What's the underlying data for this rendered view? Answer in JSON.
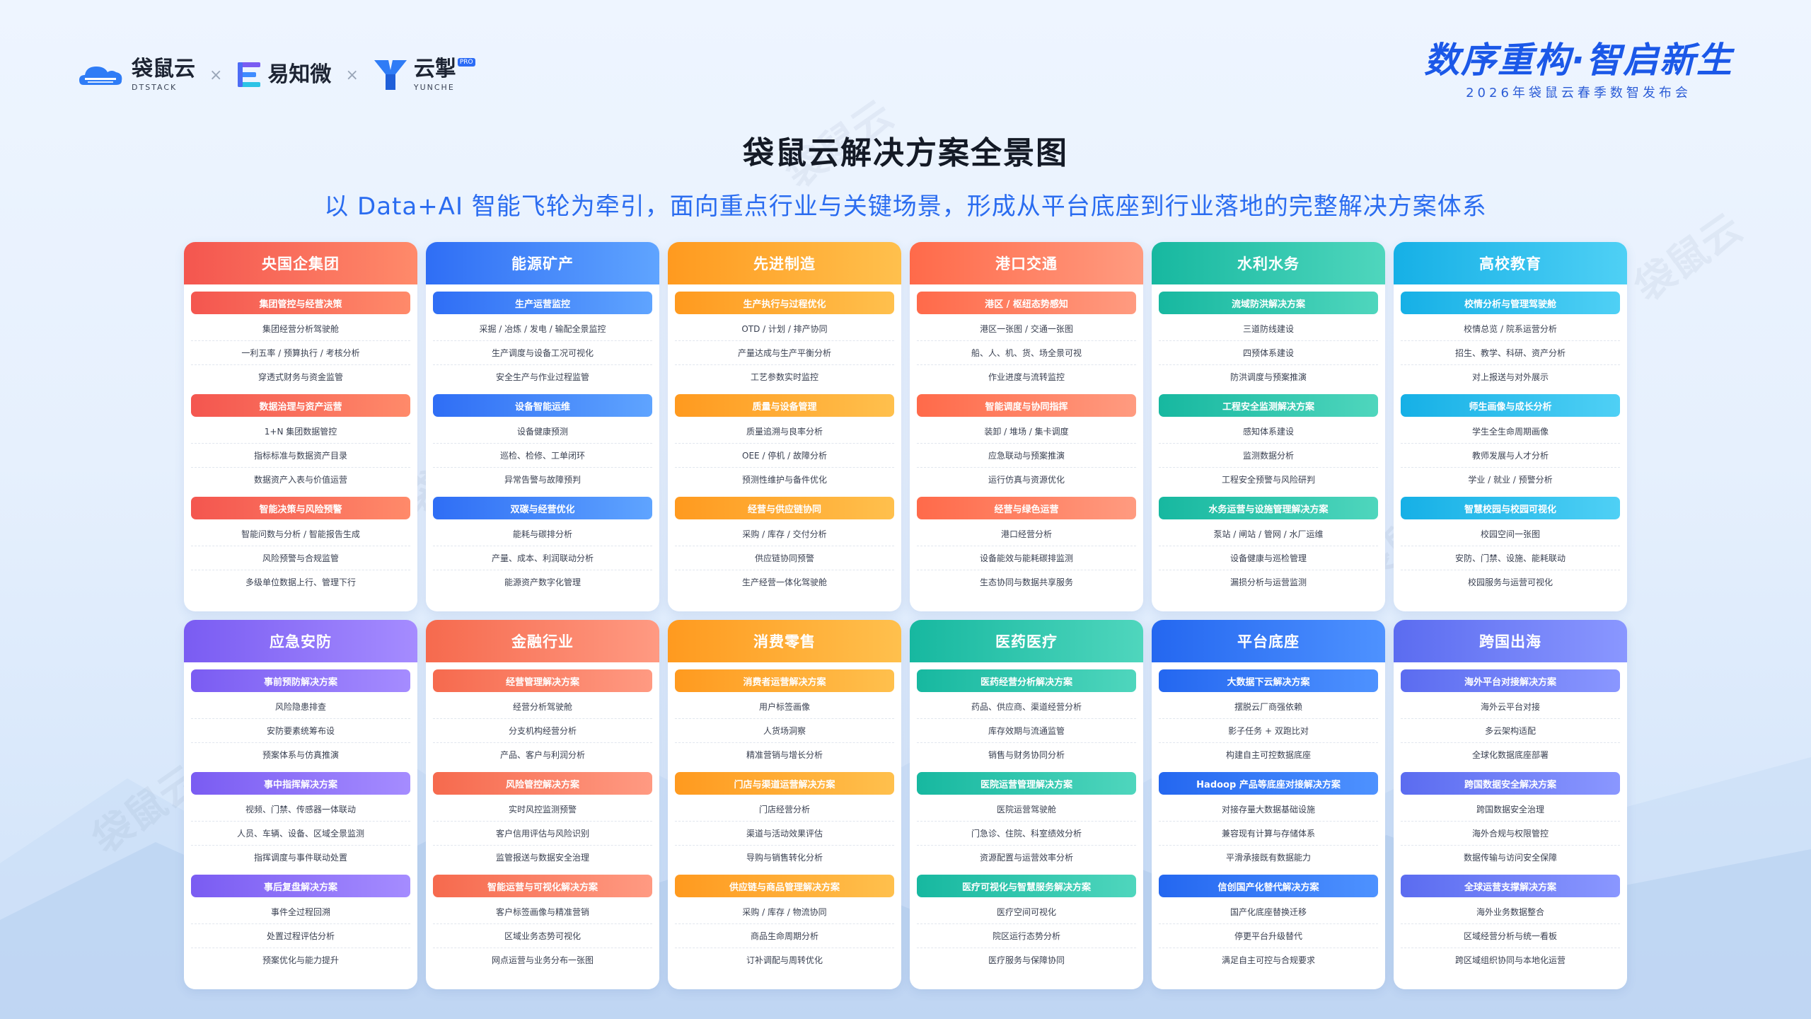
{
  "logos": {
    "brand1": "袋鼠云",
    "brand1_sub": "DTSTACK",
    "brand2": "易知微",
    "brand3": "云掣",
    "brand3_sub": "YUNCHE",
    "brand3_tag": "PRO",
    "separator": "×"
  },
  "event": {
    "title": "数序重构·智启新生",
    "subtitle": "2026年袋鼠云春季数智发布会"
  },
  "page": {
    "title": "袋鼠云解决方案全景图",
    "subtitle": "以 Data+AI 智能飞轮为牵引，面向重点行业与关键场景，形成从平台底座到行业落地的完整解决方案体系",
    "watermark": "袋鼠云"
  },
  "cards": [
    {
      "title": "央国企集团",
      "color": "c-red",
      "sections": [
        {
          "title": "集团管控与经营决策",
          "items": [
            "集团经营分析驾驶舱",
            "一利五率 / 预算执行 / 考核分析",
            "穿透式财务与资金监管"
          ]
        },
        {
          "title": "数据治理与资产运营",
          "items": [
            "1+N 集团数据管控",
            "指标标准与数据资产目录",
            "数据资产入表与价值运营"
          ]
        },
        {
          "title": "智能决策与风险预警",
          "items": [
            "智能问数与分析 / 智能报告生成",
            "风险预警与合规监管",
            "多级单位数据上行、管理下行"
          ]
        }
      ]
    },
    {
      "title": "能源矿产",
      "color": "c-blue",
      "sections": [
        {
          "title": "生产运营监控",
          "items": [
            "采掘 / 冶炼 / 发电 / 输配全景监控",
            "生产调度与设备工况可视化",
            "安全生产与作业过程监管"
          ]
        },
        {
          "title": "设备智能运维",
          "items": [
            "设备健康预测",
            "巡检、检修、工单闭环",
            "异常告警与故障预判"
          ]
        },
        {
          "title": "双碳与经营优化",
          "items": [
            "能耗与碳排分析",
            "产量、成本、利润联动分析",
            "能源资产数字化管理"
          ]
        }
      ]
    },
    {
      "title": "先进制造",
      "color": "c-orange",
      "sections": [
        {
          "title": "生产执行与过程优化",
          "items": [
            "OTD / 计划 / 排产协同",
            "产量达成与生产平衡分析",
            "工艺参数实时监控"
          ]
        },
        {
          "title": "质量与设备管理",
          "items": [
            "质量追溯与良率分析",
            "OEE / 停机 / 故障分析",
            "预测性维护与备件优化"
          ]
        },
        {
          "title": "经营与供应链协同",
          "items": [
            "采购 / 库存 / 交付分析",
            "供应链协同预警",
            "生产经营一体化驾驶舱"
          ]
        }
      ]
    },
    {
      "title": "港口交通",
      "color": "c-salmon",
      "sections": [
        {
          "title": "港区 / 枢纽态势感知",
          "items": [
            "港区一张图 / 交通一张图",
            "船、人、机、货、场全景可视",
            "作业进度与流转监控"
          ]
        },
        {
          "title": "智能调度与协同指挥",
          "items": [
            "装卸 / 堆场 / 集卡调度",
            "应急联动与预案推演",
            "运行仿真与资源优化"
          ]
        },
        {
          "title": "经营与绿色运营",
          "items": [
            "港口经营分析",
            "设备能效与能耗碳排监测",
            "生态协同与数据共享服务"
          ]
        }
      ]
    },
    {
      "title": "水利水务",
      "color": "c-teal",
      "sections": [
        {
          "title": "流域防洪解决方案",
          "items": [
            "三道防线建设",
            "四预体系建设",
            "防洪调度与预案推演"
          ]
        },
        {
          "title": "工程安全监测解决方案",
          "items": [
            "感知体系建设",
            "监测数据分析",
            "工程安全预警与风险研判"
          ]
        },
        {
          "title": "水务运营与设施管理解决方案",
          "items": [
            "泵站 / 闸站 / 管网 / 水厂运维",
            "设备健康与巡检管理",
            "漏损分析与运营监测"
          ]
        }
      ]
    },
    {
      "title": "高校教育",
      "color": "c-cyan",
      "sections": [
        {
          "title": "校情分析与管理驾驶舱",
          "items": [
            "校情总览 / 院系运营分析",
            "招生、教学、科研、资产分析",
            "对上报送与对外展示"
          ]
        },
        {
          "title": "师生画像与成长分析",
          "items": [
            "学生全生命周期画像",
            "教师发展与人才分析",
            "学业 / 就业 / 预警分析"
          ]
        },
        {
          "title": "智慧校园与校园可视化",
          "items": [
            "校园空间一张图",
            "安防、门禁、设施、能耗联动",
            "校园服务与运营可视化"
          ]
        }
      ]
    },
    {
      "title": "应急安防",
      "color": "c-purple",
      "sections": [
        {
          "title": "事前预防解决方案",
          "items": [
            "风险隐患排查",
            "安防要素统筹布设",
            "预案体系与仿真推演"
          ]
        },
        {
          "title": "事中指挥解决方案",
          "items": [
            "视频、门禁、传感器一体联动",
            "人员、车辆、设备、区域全景监测",
            "指挥调度与事件联动处置"
          ]
        },
        {
          "title": "事后复盘解决方案",
          "items": [
            "事件全过程回溯",
            "处置过程评估分析",
            "预案优化与能力提升"
          ]
        }
      ]
    },
    {
      "title": "金融行业",
      "color": "c-coral",
      "sections": [
        {
          "title": "经营管理解决方案",
          "items": [
            "经营分析驾驶舱",
            "分支机构经营分析",
            "产品、客户与利润分析"
          ]
        },
        {
          "title": "风险管控解决方案",
          "items": [
            "实时风控监测预警",
            "客户信用评估与风险识别",
            "监管报送与数据安全治理"
          ]
        },
        {
          "title": "智能运营与可视化解决方案",
          "items": [
            "客户标签画像与精准营销",
            "区域业务态势可视化",
            "网点运营与业务分布一张图"
          ]
        }
      ]
    },
    {
      "title": "消费零售",
      "color": "c-orange",
      "sections": [
        {
          "title": "消费者运营解决方案",
          "items": [
            "用户标签画像",
            "人货场洞察",
            "精准营销与增长分析"
          ]
        },
        {
          "title": "门店与渠道运营解决方案",
          "items": [
            "门店经营分析",
            "渠道与活动效果评估",
            "导购与销售转化分析"
          ]
        },
        {
          "title": "供应链与商品管理解决方案",
          "items": [
            "采购 / 库存 / 物流协同",
            "商品生命周期分析",
            "订补调配与周转优化"
          ]
        }
      ]
    },
    {
      "title": "医药医疗",
      "color": "c-teal",
      "sections": [
        {
          "title": "医药经营分析解决方案",
          "items": [
            "药品、供应商、渠道经营分析",
            "库存效期与流通监管",
            "销售与财务协同分析"
          ]
        },
        {
          "title": "医院运营管理解决方案",
          "items": [
            "医院运营驾驶舱",
            "门急诊、住院、科室绩效分析",
            "资源配置与运营效率分析"
          ]
        },
        {
          "title": "医疗可视化与智慧服务解决方案",
          "items": [
            "医疗空间可视化",
            "院区运行态势分析",
            "医疗服务与保障协同"
          ]
        }
      ]
    },
    {
      "title": "平台底座",
      "color": "c-royal",
      "sections": [
        {
          "title": "大数据下云解决方案",
          "items": [
            "摆脱云厂商强依赖",
            "影子任务 + 双跑比对",
            "构建自主可控数据底座"
          ]
        },
        {
          "title": "Hadoop 产品等底座对接解决方案",
          "items": [
            "对接存量大数据基础设施",
            "兼容现有计算与存储体系",
            "平滑承接既有数据能力"
          ]
        },
        {
          "title": "信创国产化替代解决方案",
          "items": [
            "国产化底座替换迁移",
            "停更平台升级替代",
            "满足自主可控与合规要求"
          ]
        }
      ]
    },
    {
      "title": "跨国出海",
      "color": "c-indigo",
      "sections": [
        {
          "title": "海外平台对接解决方案",
          "items": [
            "海外云平台对接",
            "多云架构适配",
            "全球化数据底座部署"
          ]
        },
        {
          "title": "跨国数据安全解决方案",
          "items": [
            "跨国数据安全治理",
            "海外合规与权限管控",
            "数据传输与访问安全保障"
          ]
        },
        {
          "title": "全球运营支撑解决方案",
          "items": [
            "海外业务数据整合",
            "区域经营分析与统一看板",
            "跨区域组织协同与本地化运营"
          ]
        }
      ]
    }
  ]
}
